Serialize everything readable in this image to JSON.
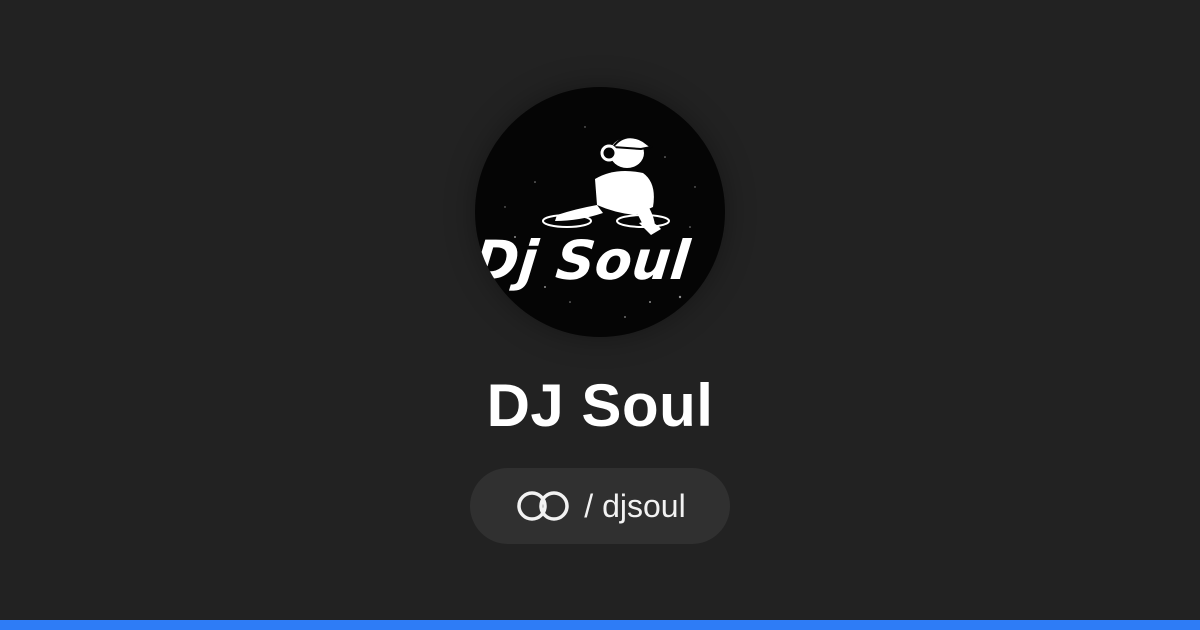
{
  "profile": {
    "logo_text": "Dj Soul",
    "name": "DJ Soul",
    "handle": "/ djsoul",
    "link_icon": "linked-rings-icon"
  },
  "colors": {
    "background": "#222222",
    "pill_background": "#303030",
    "text": "#ffffff",
    "accent_bar": "#2e7cf6"
  }
}
